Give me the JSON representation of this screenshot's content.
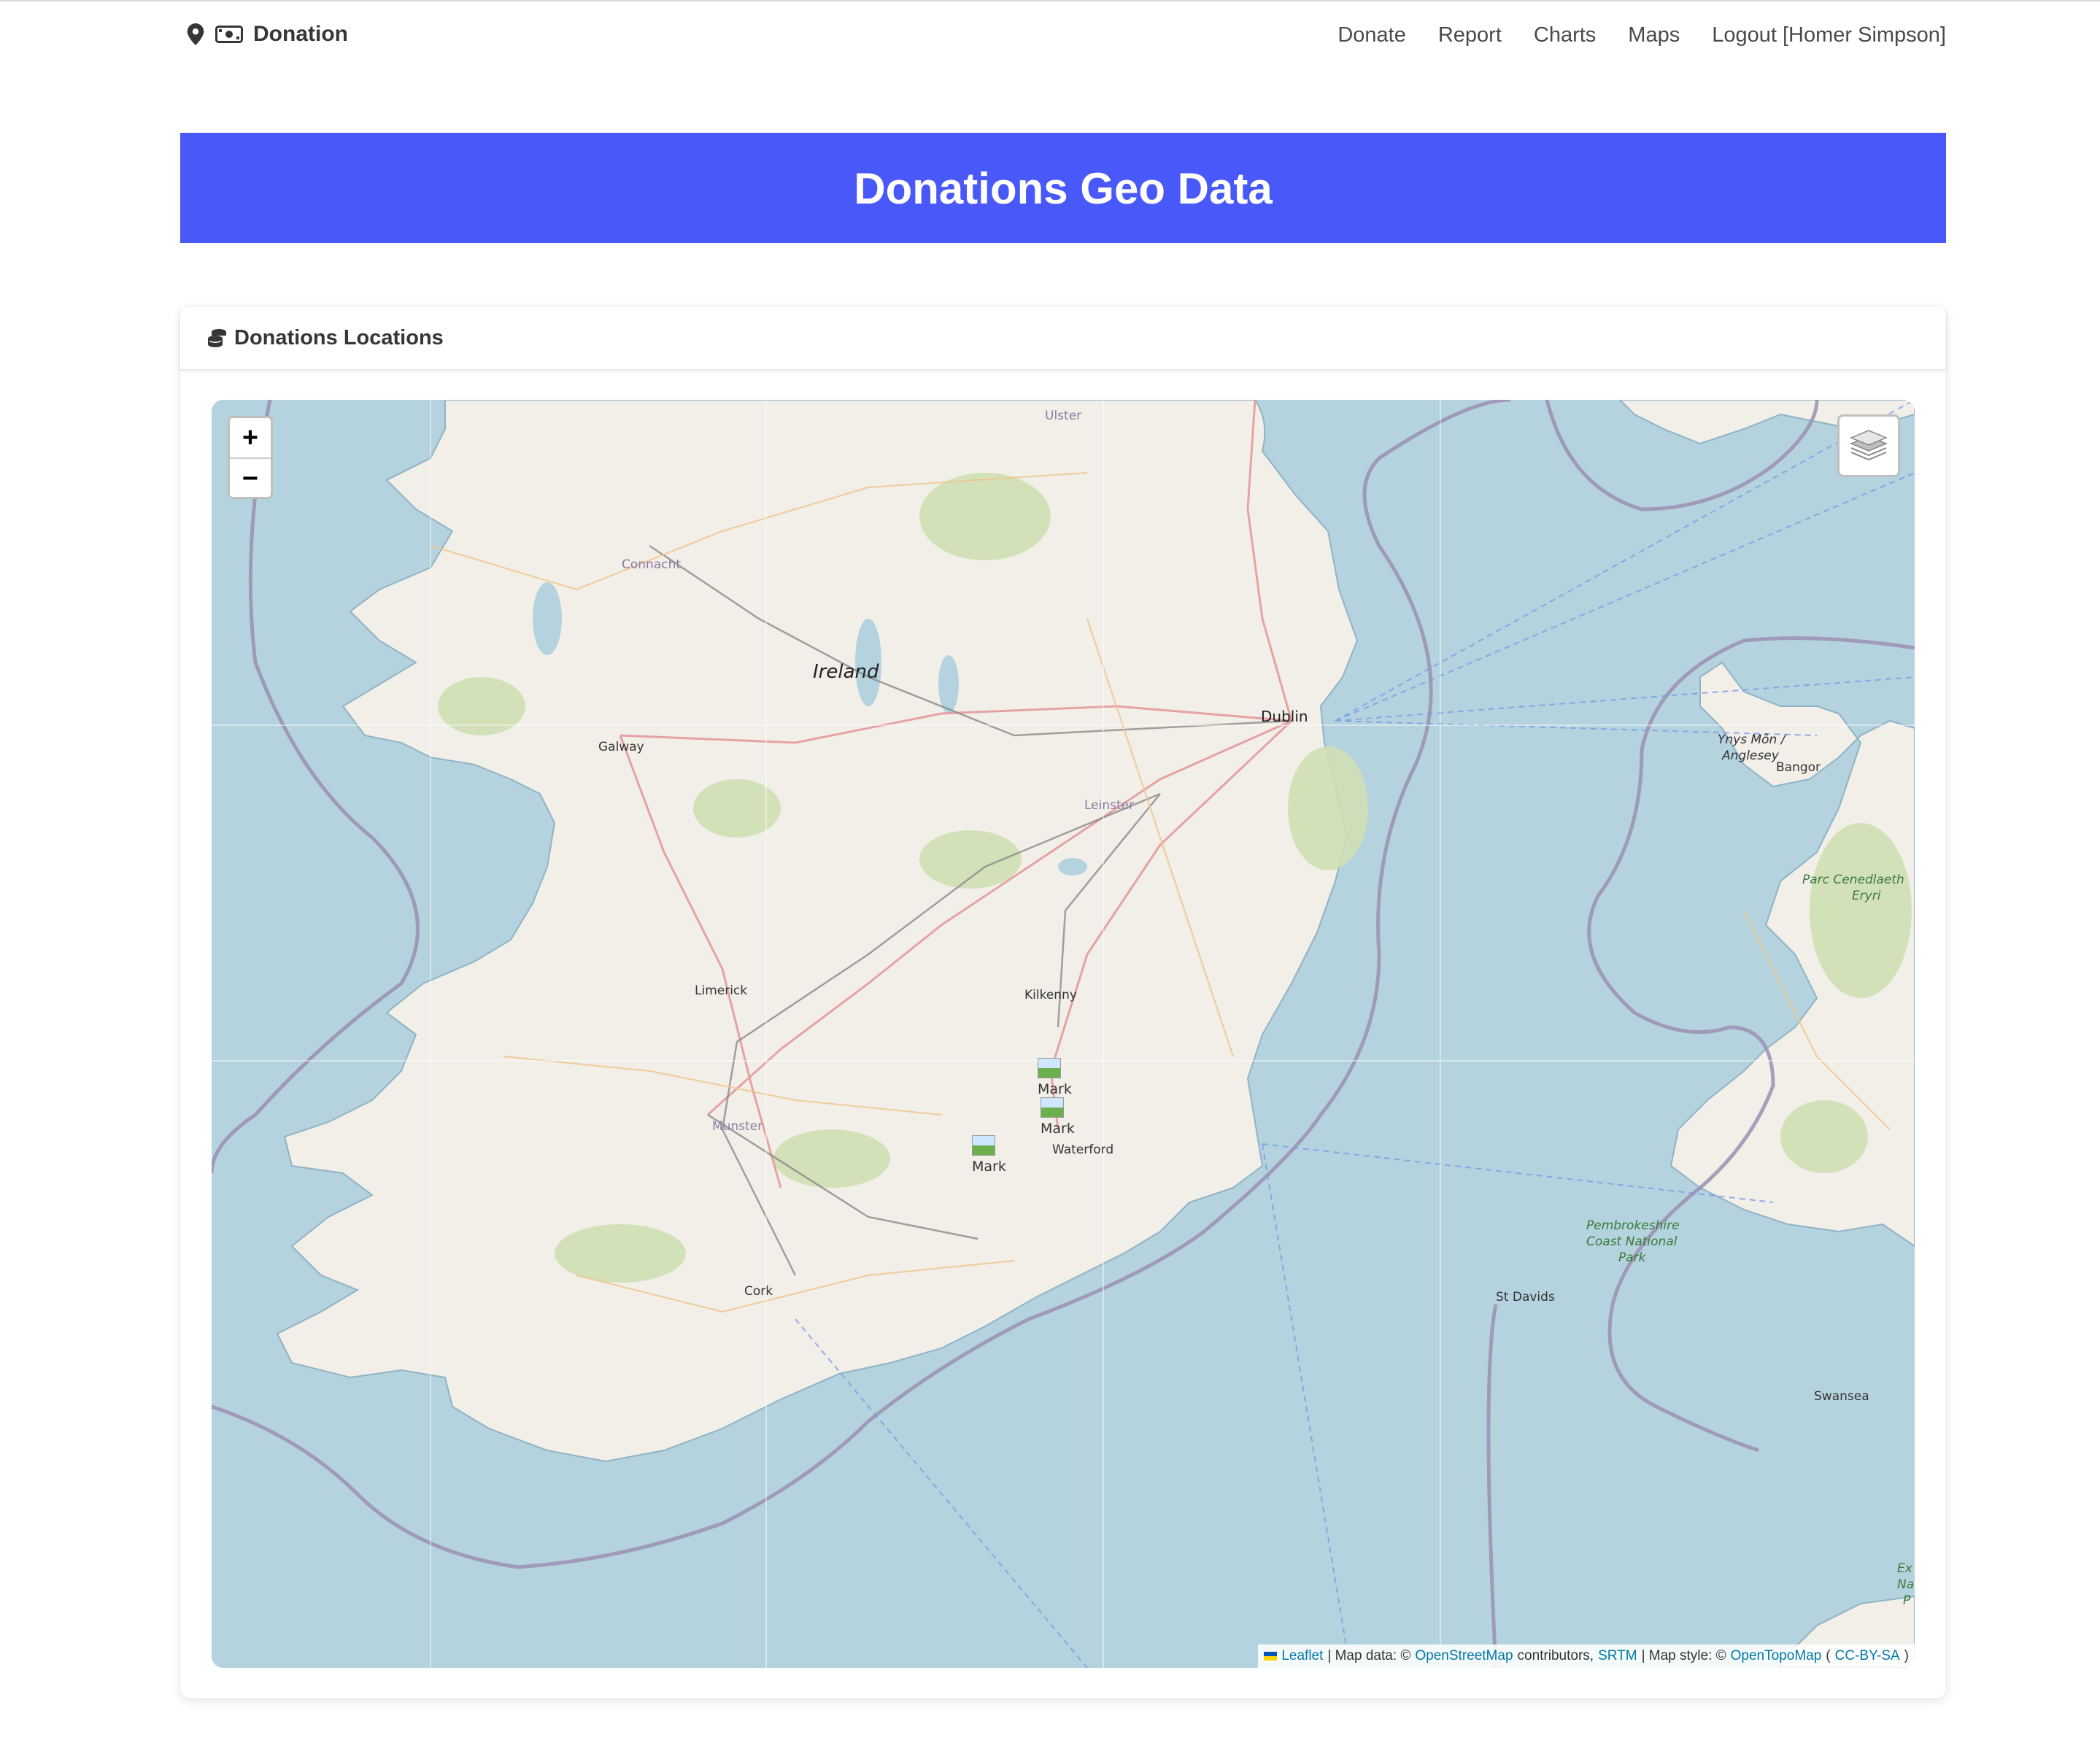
{
  "navbar": {
    "brand": "Donation",
    "links": [
      "Donate",
      "Report",
      "Charts",
      "Maps",
      "Logout [Homer Simpson]"
    ]
  },
  "hero": {
    "title": "Donations Geo Data"
  },
  "card": {
    "title": "Donations Locations"
  },
  "map": {
    "zoom_in": "+",
    "zoom_out": "−",
    "labels": {
      "ireland": "Ireland",
      "ulster": "Ulster",
      "connacht": "Connacht",
      "leinster": "Leinster",
      "munster": "Munster",
      "dublin": "Dublin",
      "galway": "Galway",
      "limerick": "Limerick",
      "kilkenny": "Kilkenny",
      "waterford": "Waterford",
      "cork": "Cork",
      "ynys_mon": "Ynys Môn /",
      "anglesey": "Anglesey",
      "bangor": "Bangor",
      "parc1": "Parc Cenedlaeth",
      "parc2": "Eryri",
      "pembs1": "Pembrokeshire",
      "pembs2": "Coast National",
      "pembs3": "Park",
      "st_davids": "St Davids",
      "swansea": "Swansea",
      "ex1": "Ex",
      "ex2": "Na",
      "ex3": "P"
    },
    "markers": [
      {
        "alt": "Mark"
      },
      {
        "alt": "Mark"
      },
      {
        "alt": "Mark"
      }
    ],
    "attribution": {
      "leaflet": "Leaflet",
      "sep1": "| Map data: ©",
      "osm": "OpenStreetMap",
      "contributors": "contributors,",
      "srtm": "SRTM",
      "sep2": "| Map style: ©",
      "opentopo": "OpenTopoMap",
      "open_paren": "(",
      "license": "CC-BY-SA",
      "close_paren": ")"
    }
  },
  "colors": {
    "hero": "#4858f9",
    "sea": "#b5d3de",
    "land": "#f2efe9",
    "link": "#0078a8"
  }
}
